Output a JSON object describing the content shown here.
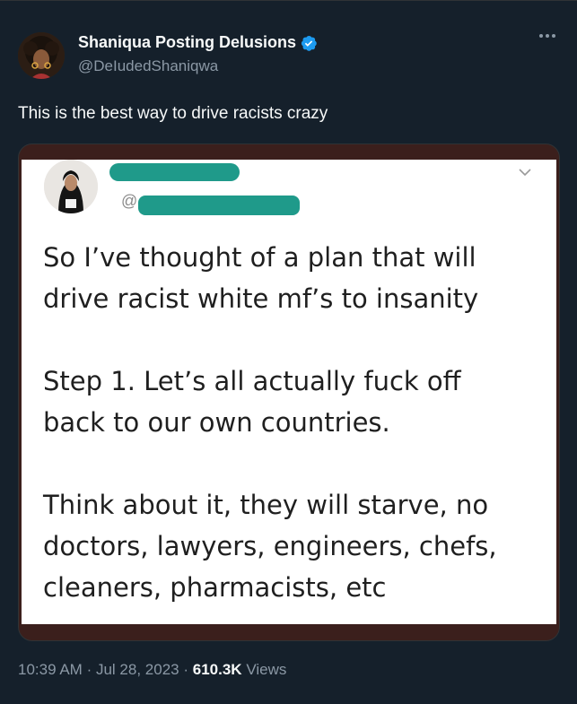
{
  "author": {
    "name": "Shaniqua Posting Delusions",
    "handle": "@DeIudedShaniqwa",
    "verified": true,
    "accent_color": "#1d9bf0"
  },
  "tweet": {
    "text": "This is the best way to drive racists crazy"
  },
  "embedded_screenshot": {
    "at_symbol": "@",
    "paragraphs": [
      "So I’ve thought of a plan that will\ndrive racist white mf’s to insanity",
      "Step 1. Let’s all actually fuck off\nback to our own countries.",
      "Think about it, they will starve, no\ndoctors, lawyers, engineers, chefs,\ncleaners, pharmacists, etc"
    ],
    "redaction_color": "#1f9a8a"
  },
  "meta": {
    "time": "10:39 AM",
    "sep1": "·",
    "date": "Jul 28, 2023",
    "sep2": "·",
    "views_count": "610.3K",
    "views_label": "Views"
  },
  "icons": {
    "more": "more-horizontal-icon",
    "verified": "verified-badge-icon",
    "chevron": "chevron-down-icon"
  }
}
